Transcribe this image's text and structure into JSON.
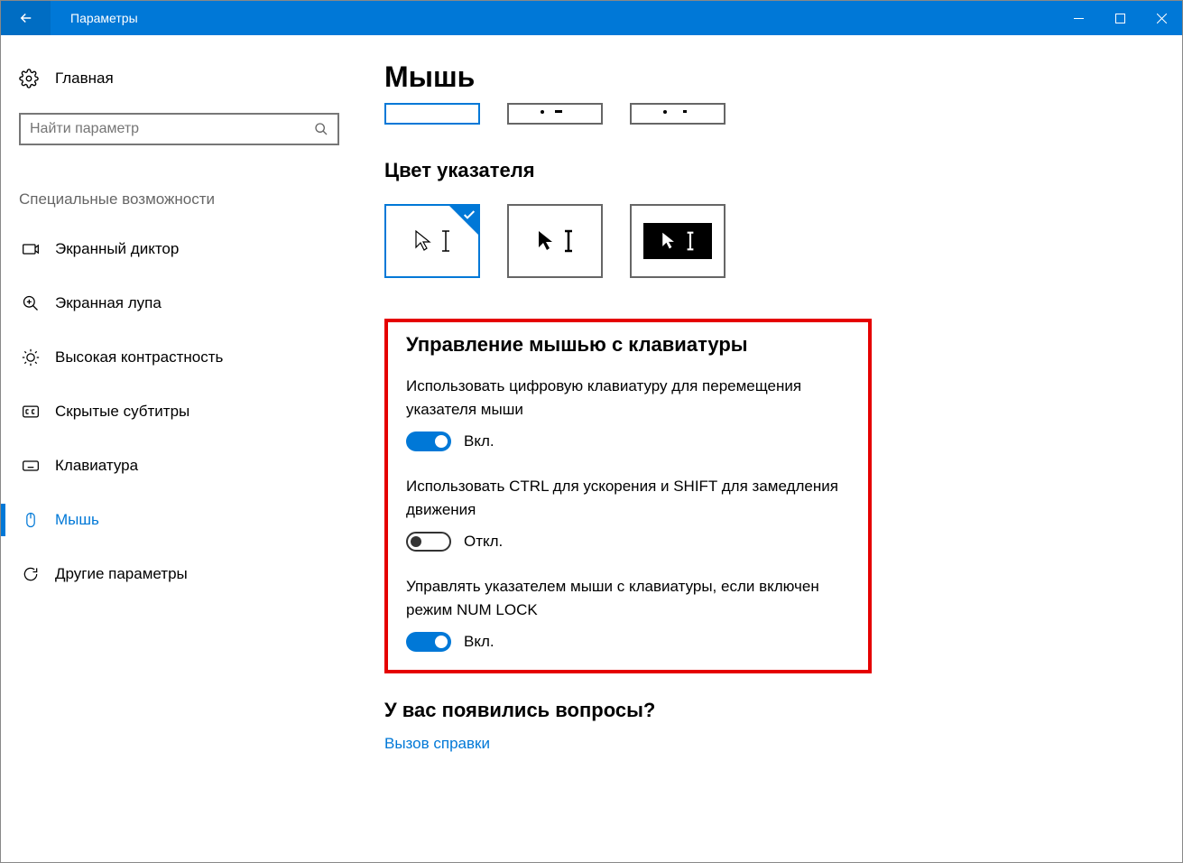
{
  "window": {
    "title": "Параметры"
  },
  "sidebar": {
    "home": "Главная",
    "search_placeholder": "Найти параметр",
    "section": "Специальные возможности",
    "items": [
      {
        "label": "Экранный диктор"
      },
      {
        "label": "Экранная лупа"
      },
      {
        "label": "Высокая контрастность"
      },
      {
        "label": "Скрытые субтитры"
      },
      {
        "label": "Клавиатура"
      },
      {
        "label": "Мышь"
      },
      {
        "label": "Другие параметры"
      }
    ]
  },
  "main": {
    "title": "Мышь",
    "pointer_color_heading": "Цвет указателя",
    "keyboard_mouse": {
      "heading": "Управление мышью с клавиатуры",
      "opt1": {
        "label": "Использовать цифровую клавиатуру для перемещения указателя мыши",
        "state": "Вкл."
      },
      "opt2": {
        "label": "Использовать CTRL для ускорения и SHIFT для замедления движения",
        "state": "Откл."
      },
      "opt3": {
        "label": "Управлять указателем мыши с клавиатуры, если включен режим NUM LOCK",
        "state": "Вкл."
      }
    },
    "questions": {
      "heading": "У вас появились вопросы?",
      "link": "Вызов справки"
    }
  }
}
